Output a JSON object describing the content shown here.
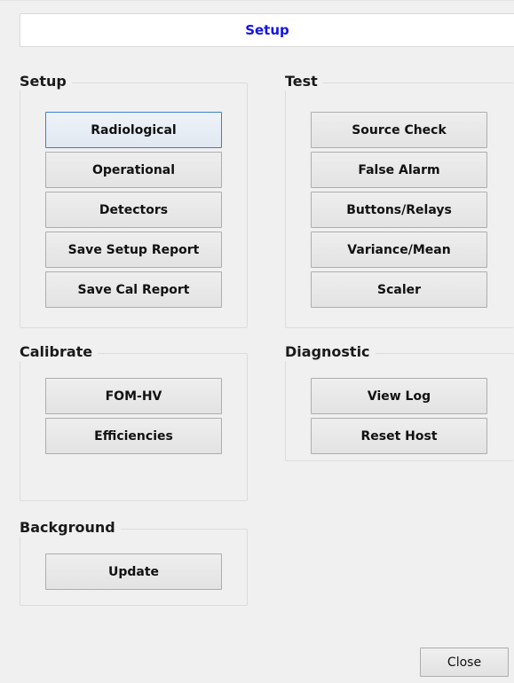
{
  "tab": {
    "title": "Setup"
  },
  "setup": {
    "label": "Setup",
    "buttons": [
      "Radiological",
      "Operational",
      "Detectors",
      "Save Setup Report",
      "Save Cal Report"
    ]
  },
  "test": {
    "label": "Test",
    "buttons": [
      "Source Check",
      "False Alarm",
      "Buttons/Relays",
      "Variance/Mean",
      "Scaler"
    ]
  },
  "calibrate": {
    "label": "Calibrate",
    "buttons": [
      "FOM-HV",
      "Efficiencies"
    ]
  },
  "diagnostic": {
    "label": "Diagnostic",
    "buttons": [
      "View Log",
      "Reset Host"
    ]
  },
  "background": {
    "label": "Background",
    "buttons": [
      "Update"
    ]
  },
  "footer": {
    "close_label": "Close"
  }
}
